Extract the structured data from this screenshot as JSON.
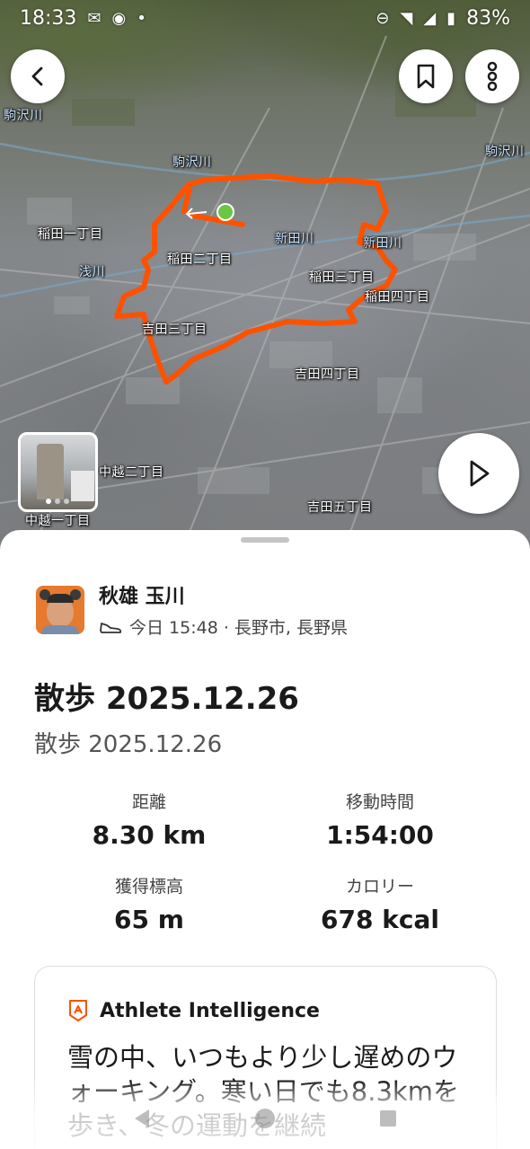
{
  "status_bar": {
    "time": "18:33",
    "battery": "83%"
  },
  "map": {
    "labels": [
      {
        "text": "駒沢川",
        "style": "blue"
      },
      {
        "text": "駒沢川",
        "style": "blue"
      },
      {
        "text": "駒沢川",
        "style": "blue"
      },
      {
        "text": "稲田一丁目",
        "style": "white"
      },
      {
        "text": "稲田二丁目",
        "style": "white"
      },
      {
        "text": "新田川",
        "style": "blue"
      },
      {
        "text": "新田川",
        "style": "blue"
      },
      {
        "text": "浅川",
        "style": "blue"
      },
      {
        "text": "稲田三丁目",
        "style": "white"
      },
      {
        "text": "稲田四丁目",
        "style": "white"
      },
      {
        "text": "吉田三丁目",
        "style": "white"
      },
      {
        "text": "吉田四丁目",
        "style": "white"
      },
      {
        "text": "中越二丁目",
        "style": "white"
      },
      {
        "text": "吉田五丁目",
        "style": "white"
      },
      {
        "text": "中越一丁目",
        "style": "white"
      }
    ],
    "route_color": "#fc5200",
    "start_marker_color": "#6cc644"
  },
  "athlete": {
    "name": "秋雄 玉川",
    "meta": "今日 15:48 · 長野市, 長野県"
  },
  "activity": {
    "title": "散歩 2025.12.26",
    "description": "散歩 2025.12.26"
  },
  "stats": [
    {
      "label": "距離",
      "value": "8.30 km"
    },
    {
      "label": "移動時間",
      "value": "1:54:00"
    },
    {
      "label": "獲得標高",
      "value": "65 m"
    },
    {
      "label": "カロリー",
      "value": "678 kcal"
    }
  ],
  "ai_card": {
    "title": "Athlete Intelligence",
    "text": "雪の中、いつもより少し遅めのウォーキング。寒い日でも8.3kmを歩き、冬の運動を継続"
  },
  "colors": {
    "accent": "#fc5200",
    "text": "#1a1a1a"
  }
}
